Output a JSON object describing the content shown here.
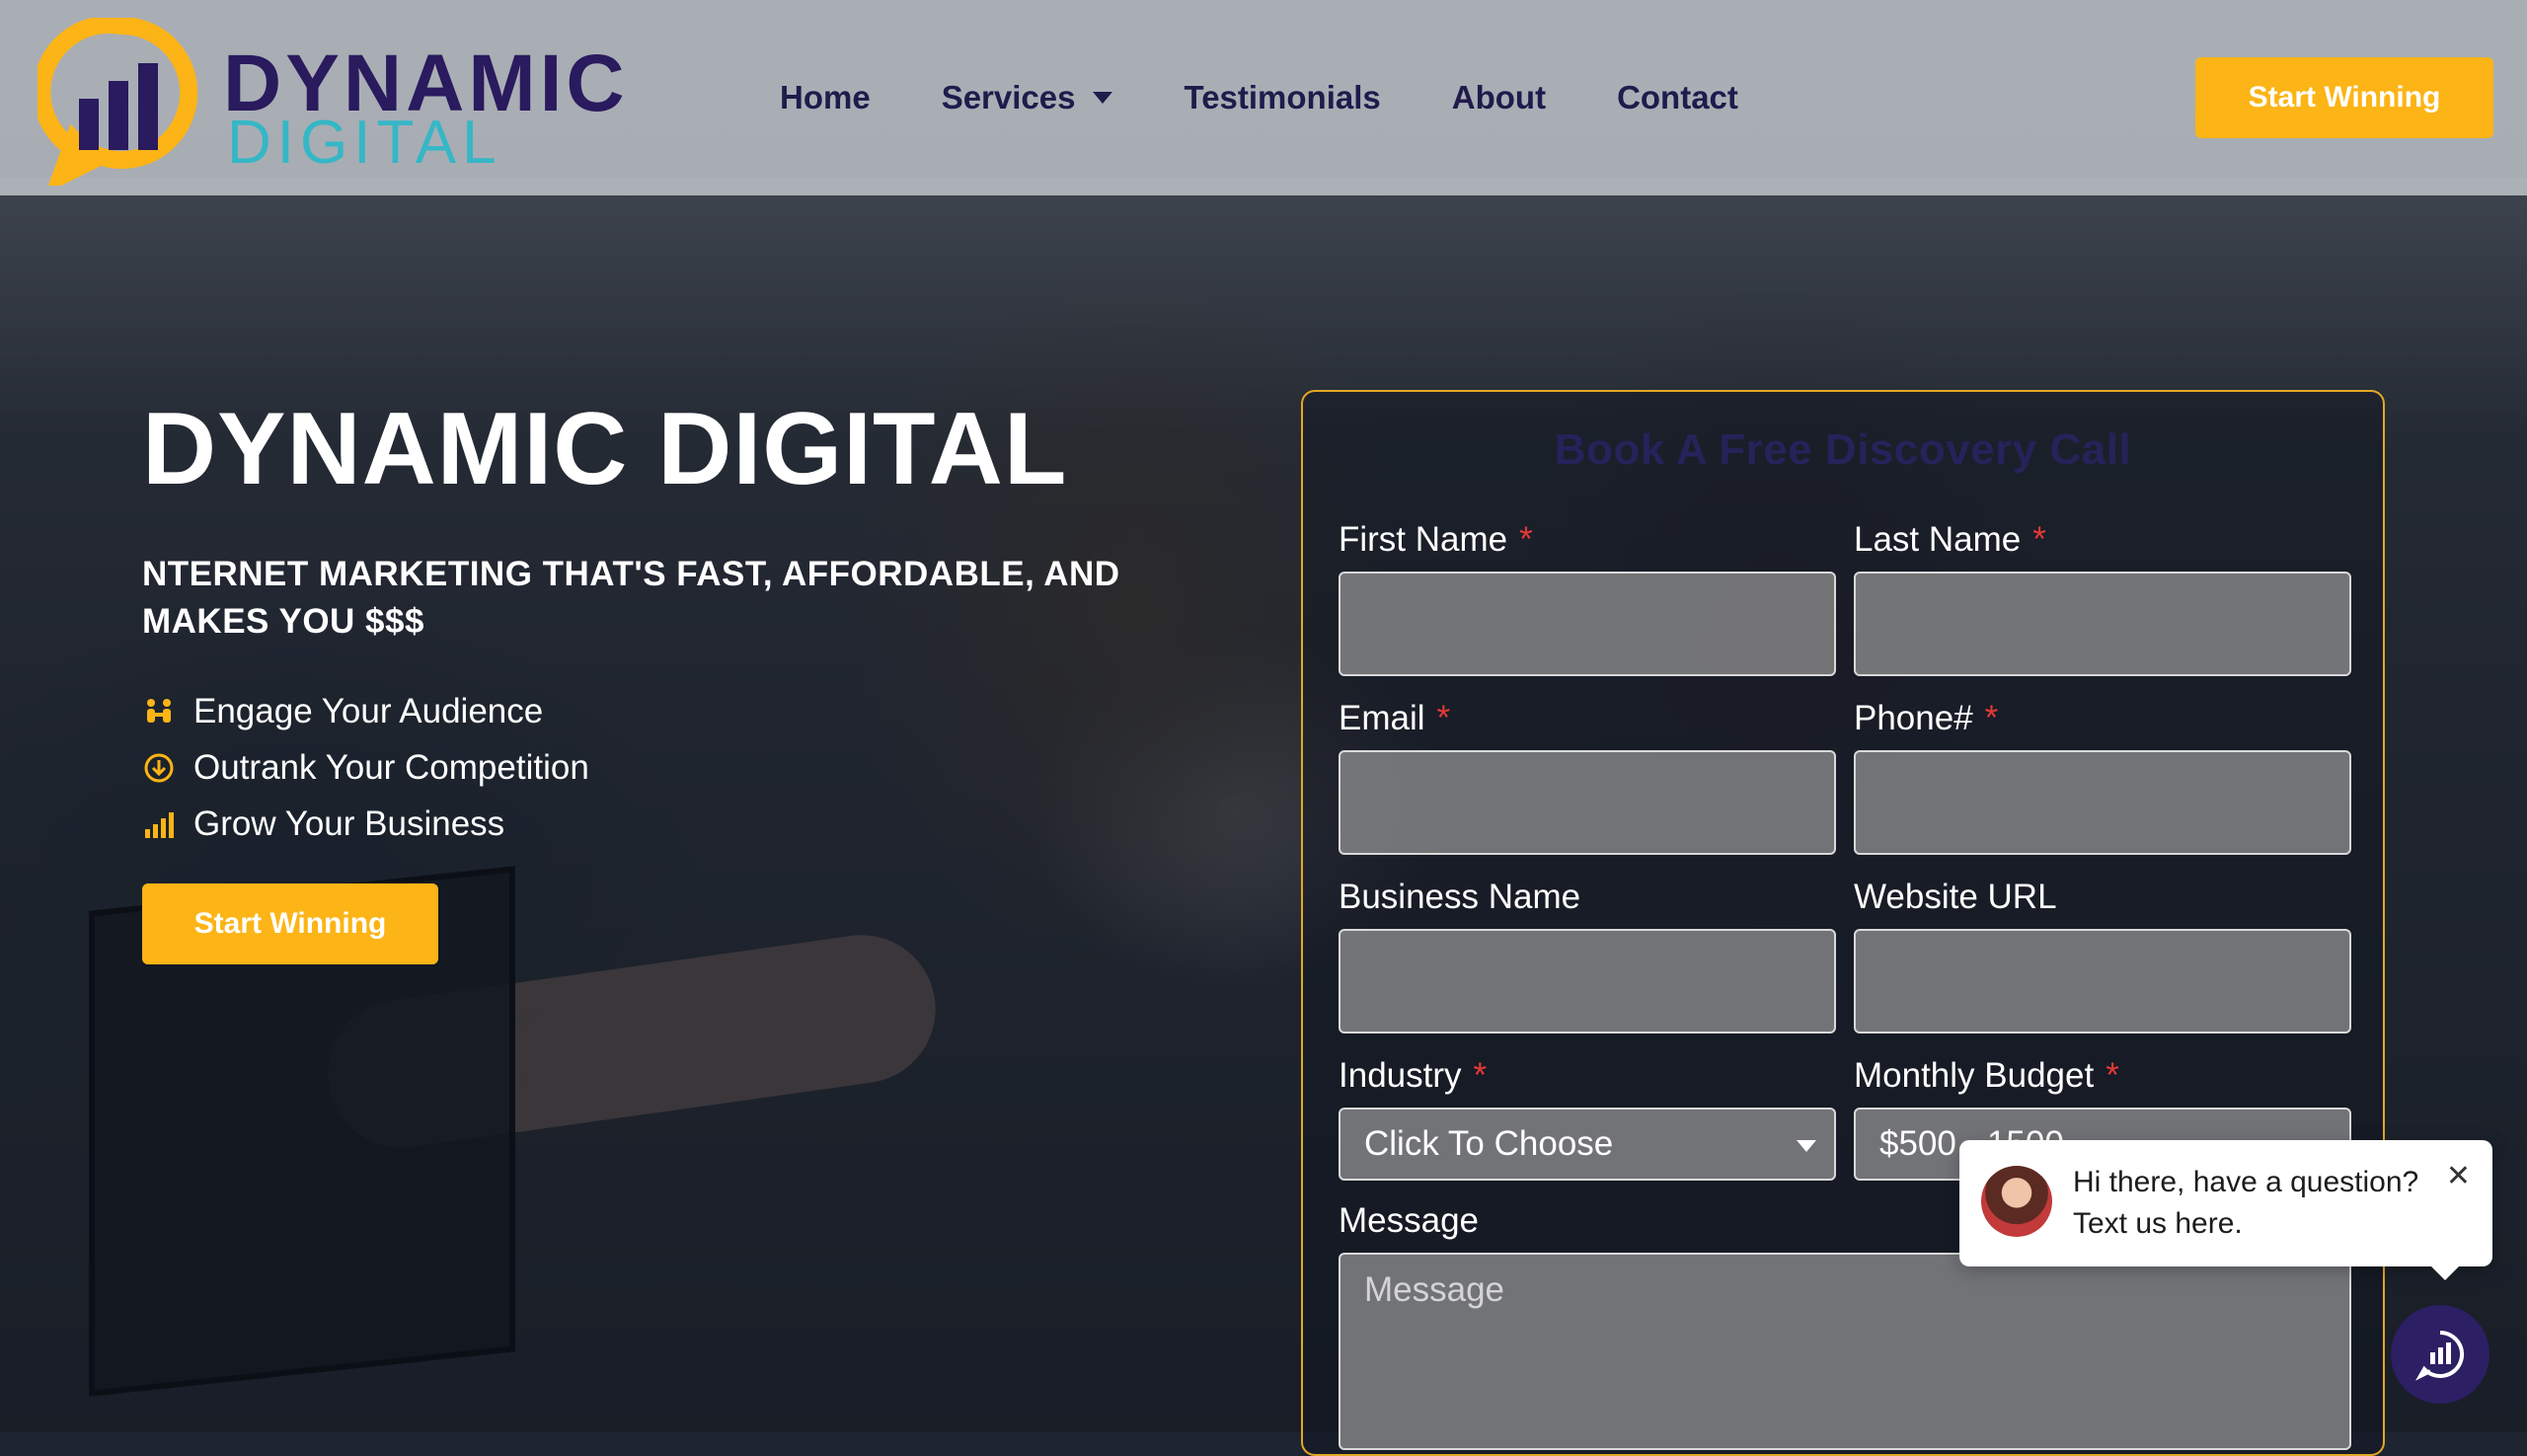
{
  "brand": {
    "name_line1": "DYNAMIC",
    "name_line2": "DIGITAL",
    "colors": {
      "purple": "#2a1a5e",
      "teal": "#35b7c6",
      "accent": "#fcb416"
    }
  },
  "nav": {
    "items": [
      {
        "label": "Home"
      },
      {
        "label": "Services",
        "has_dropdown": true
      },
      {
        "label": "Testimonials"
      },
      {
        "label": "About"
      },
      {
        "label": "Contact"
      }
    ],
    "cta_label": "Start Winning"
  },
  "hero": {
    "title": "DYNAMIC DIGITAL",
    "subtitle": "NTERNET MARKETING THAT'S FAST, AFFORDABLE, AND MAKES YOU $$$",
    "bullets": [
      {
        "icon": "people-icon",
        "text": "Engage Your Audience"
      },
      {
        "icon": "arrow-down-circle-icon",
        "text": "Outrank Your Competition"
      },
      {
        "icon": "bar-chart-icon",
        "text": "Grow Your Business"
      }
    ],
    "cta_label": "Start Winning"
  },
  "form": {
    "title": "Book A Free Discovery Call",
    "required_marker": "*",
    "fields": {
      "first_name": {
        "label": "First Name",
        "required": true,
        "value": ""
      },
      "last_name": {
        "label": "Last Name",
        "required": true,
        "value": ""
      },
      "email": {
        "label": "Email",
        "required": true,
        "value": ""
      },
      "phone": {
        "label": "Phone#",
        "required": true,
        "value": ""
      },
      "business_name": {
        "label": "Business Name",
        "required": false,
        "value": ""
      },
      "website_url": {
        "label": "Website URL",
        "required": false,
        "value": ""
      },
      "industry": {
        "label": "Industry",
        "required": true,
        "selected": "Click To Choose"
      },
      "monthly_budget": {
        "label": "Monthly Budget",
        "required": true,
        "selected": "$500 - 1500"
      },
      "message": {
        "label": "Message",
        "placeholder": "Message"
      }
    }
  },
  "chat_widget": {
    "message": "Hi there, have a question? Text us here.",
    "close_glyph": "✕"
  }
}
